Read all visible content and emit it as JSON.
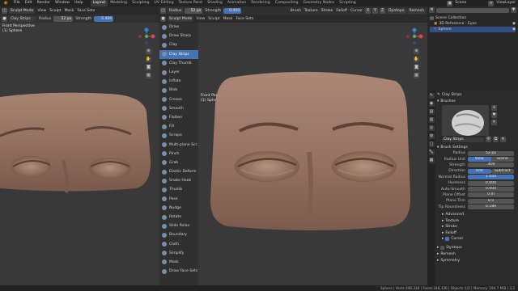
{
  "menu": [
    "File",
    "Edit",
    "Render",
    "Window",
    "Help"
  ],
  "workspaces": [
    "Layout",
    "Modeling",
    "Sculpting",
    "UV Editing",
    "Texture Paint",
    "Shading",
    "Animation",
    "Rendering",
    "Compositing",
    "Geometry Nodes",
    "Scripting"
  ],
  "scene": "Scene",
  "view_layer": "ViewLayer",
  "left_header": {
    "mode": "Sculpt Mode",
    "view": "View",
    "sculpt": "Sculpt",
    "mask": "Mask",
    "face_sets": "Face Sets"
  },
  "left_tool_header": {
    "brush": "Clay Strips",
    "radius_label": "Radius",
    "radius_value": "52 px",
    "strength_label": "Strength",
    "strength_value": "0.400"
  },
  "mid_header": {
    "brush": "Radius",
    "radius_value": "52 px",
    "strength_label": "Strength",
    "strength_value": "0.400",
    "menus": [
      "Brush",
      "Texture",
      "Stroke",
      "Falloff",
      "Cursor"
    ],
    "dyntopo": "Dyntopo",
    "remesh": "Remesh"
  },
  "viewport_left": {
    "view_name": "Front Perspective",
    "object": "(1) Sphere"
  },
  "viewport_right": {
    "view_name": "Front Perspective",
    "object": "(1) Sphere"
  },
  "tools": [
    "Draw",
    "Draw Sharp",
    "Clay",
    "Clay Strips",
    "Clay Thumb",
    "Layer",
    "Inflate",
    "Blob",
    "Crease",
    "Smooth",
    "Flatten",
    "Fill",
    "Scrape",
    "Multi-plane Scr...",
    "Pinch",
    "Grab",
    "Elastic Deform",
    "Snake Hook",
    "Thumb",
    "Pose",
    "Nudge",
    "Rotate",
    "Slide Relax",
    "Boundary",
    "Cloth",
    "Simplify",
    "Mask",
    "Draw Face Sets"
  ],
  "active_tool_index": 3,
  "outliner": {
    "collection": "Scene Collection",
    "items": [
      "3D Reference - Eyes",
      "Sphere"
    ]
  },
  "properties": {
    "tool_name": "Clay Strips",
    "brushes_section": "Brushes",
    "brush_preview_label": "Clay Strips",
    "brush_settings": "Brush Settings",
    "radius_label": "Radius",
    "radius_value": "52 px",
    "radius_unit_label": "Radius Unit",
    "radius_unit_options": [
      "View",
      "Scene"
    ],
    "strength_label": "Strength",
    "strength_value": ".400",
    "strength_fraction": 0.4,
    "direction_label": "Direction",
    "direction_options": [
      "Add",
      "Subtract"
    ],
    "normal_radius_label": "Normal Radius",
    "normal_radius_value": "1.550",
    "hardness_label": "Hardness",
    "hardness_value": "0.000",
    "auto_smooth_label": "Auto-Smooth",
    "auto_smooth_value": "0.000",
    "plane_offset_label": "Plane Offset",
    "plane_offset_value": "0 m",
    "plane_trim_label": "Plane Trim",
    "plane_trim_value": "0.5",
    "tip_roundness_label": "Tip Roundness",
    "tip_roundness_value": "0.180",
    "collapsed": [
      "Advanced",
      "Texture",
      "Stroke",
      "Falloff",
      "Cursor"
    ],
    "bottom_sections": [
      "Dyntopo",
      "Remesh",
      "Symmetry"
    ]
  },
  "status": "Sphere | Verts:348,338 | Faces:348,336 | Objects:1/2 | Memory: 194.7 MiB | 3.2"
}
